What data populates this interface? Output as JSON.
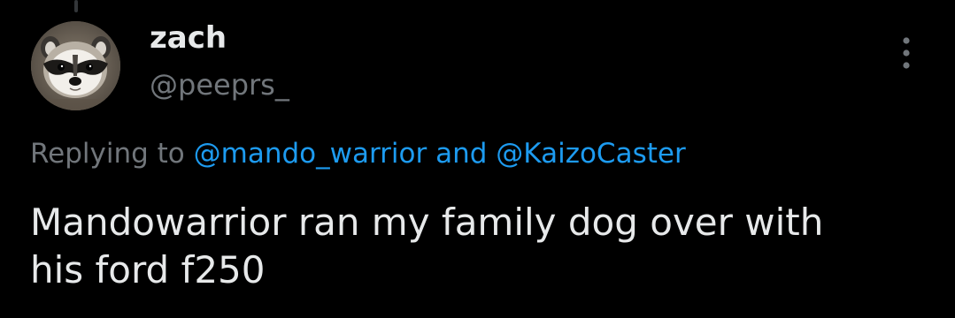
{
  "author": {
    "display_name": "zach",
    "handle": "@peeprs_",
    "avatar_icon": "raccoon-avatar"
  },
  "more_icon": "more-options-icon",
  "reply": {
    "prefix": "Replying to",
    "mention_1": "@mando_warrior",
    "conjunction": "and",
    "mention_2": "@KaizoCaster"
  },
  "tweet": {
    "line_1": "Mandowarrior ran my family dog over with",
    "line_2": "his ford f250"
  },
  "colors": {
    "background": "#000000",
    "text_primary": "#e7e9ea",
    "text_secondary": "#71767b",
    "link": "#1d9bf0"
  }
}
